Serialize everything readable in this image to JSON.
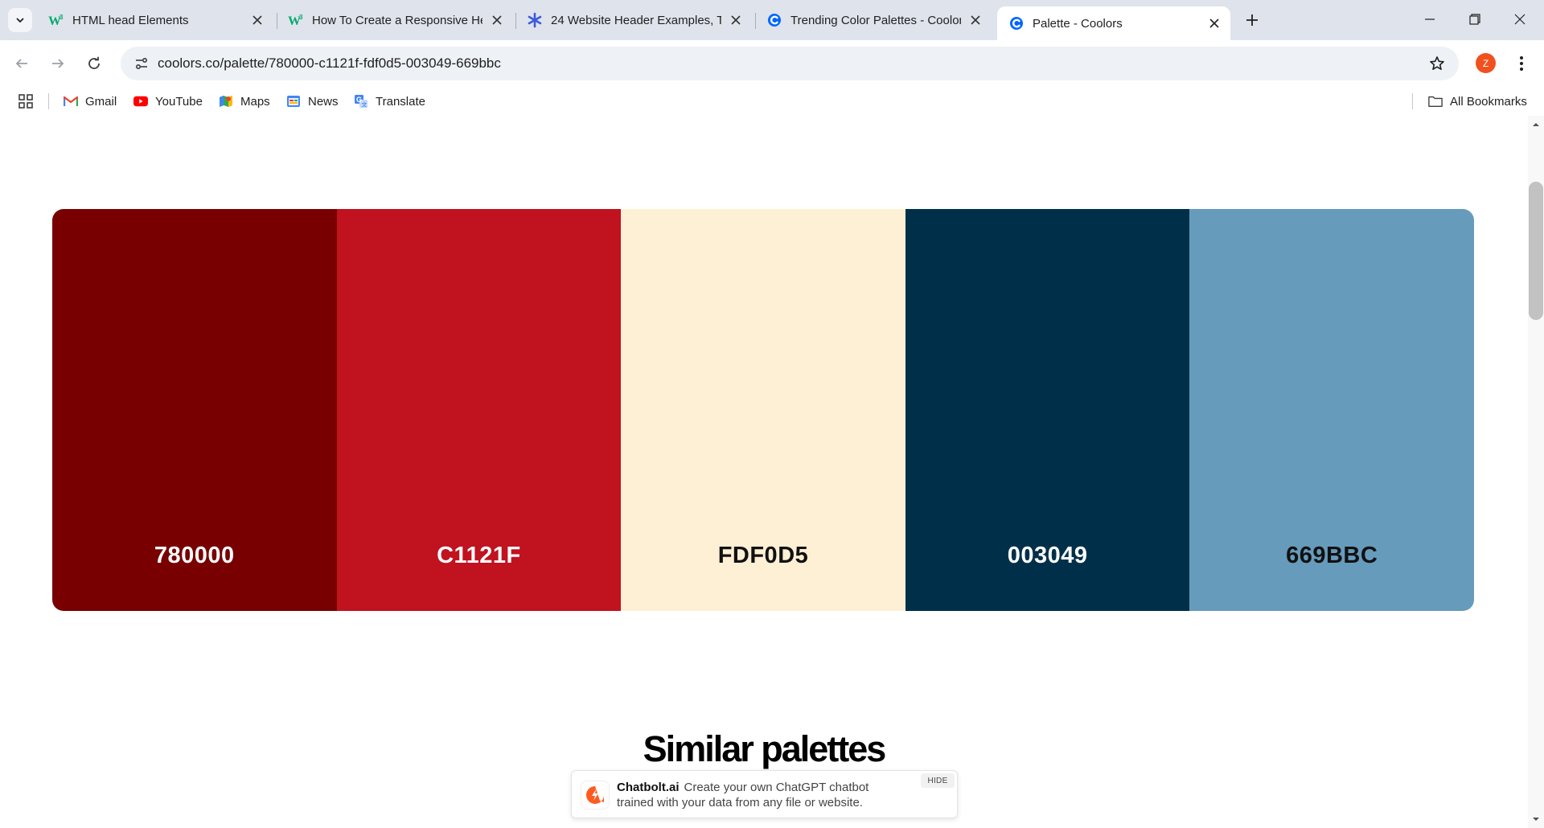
{
  "browser": {
    "tabs": [
      {
        "title": "HTML head Elements",
        "icon": "w3schools-icon",
        "active": false
      },
      {
        "title": "How To Create a Responsive Header",
        "icon": "w3schools-icon",
        "active": false
      },
      {
        "title": "24 Website Header Examples, Tips",
        "icon": "asterisk-icon",
        "active": false
      },
      {
        "title": "Trending Color Palettes - Coolors",
        "icon": "coolors-icon",
        "active": false
      },
      {
        "title": "Palette - Coolors",
        "icon": "coolors-icon",
        "active": true
      }
    ],
    "url": "coolors.co/palette/780000-c1121f-fdf0d5-003049-669bbc",
    "profile_initial": "Z",
    "bookmarks": [
      {
        "label": "Gmail",
        "icon": "gmail-icon"
      },
      {
        "label": "YouTube",
        "icon": "youtube-icon"
      },
      {
        "label": "Maps",
        "icon": "maps-icon"
      },
      {
        "label": "News",
        "icon": "news-icon"
      },
      {
        "label": "Translate",
        "icon": "translate-icon"
      }
    ],
    "all_bookmarks_label": "All Bookmarks"
  },
  "palette": {
    "swatches": [
      {
        "hex": "780000",
        "color": "#780000",
        "text_color": "#ffffff"
      },
      {
        "hex": "C1121F",
        "color": "#c1121f",
        "text_color": "#ffffff"
      },
      {
        "hex": "FDF0D5",
        "color": "#fdf0d5",
        "text_color": "#111111"
      },
      {
        "hex": "003049",
        "color": "#003049",
        "text_color": "#ffffff"
      },
      {
        "hex": "669BBC",
        "color": "#669bbc",
        "text_color": "#111111"
      }
    ]
  },
  "similar": {
    "title": "Similar palettes"
  },
  "ad": {
    "brand": "Chatbolt.ai",
    "text": "Create your own ChatGPT chatbot trained with your data from any file or website.",
    "hide_label": "HIDE"
  },
  "colors": {
    "tabstrip_bg": "#dfe3eb",
    "omnibox_bg": "#eef1f5",
    "profile": "#f0511e",
    "coolors_blue": "#0066ff",
    "w3_green": "#04aa6d"
  }
}
